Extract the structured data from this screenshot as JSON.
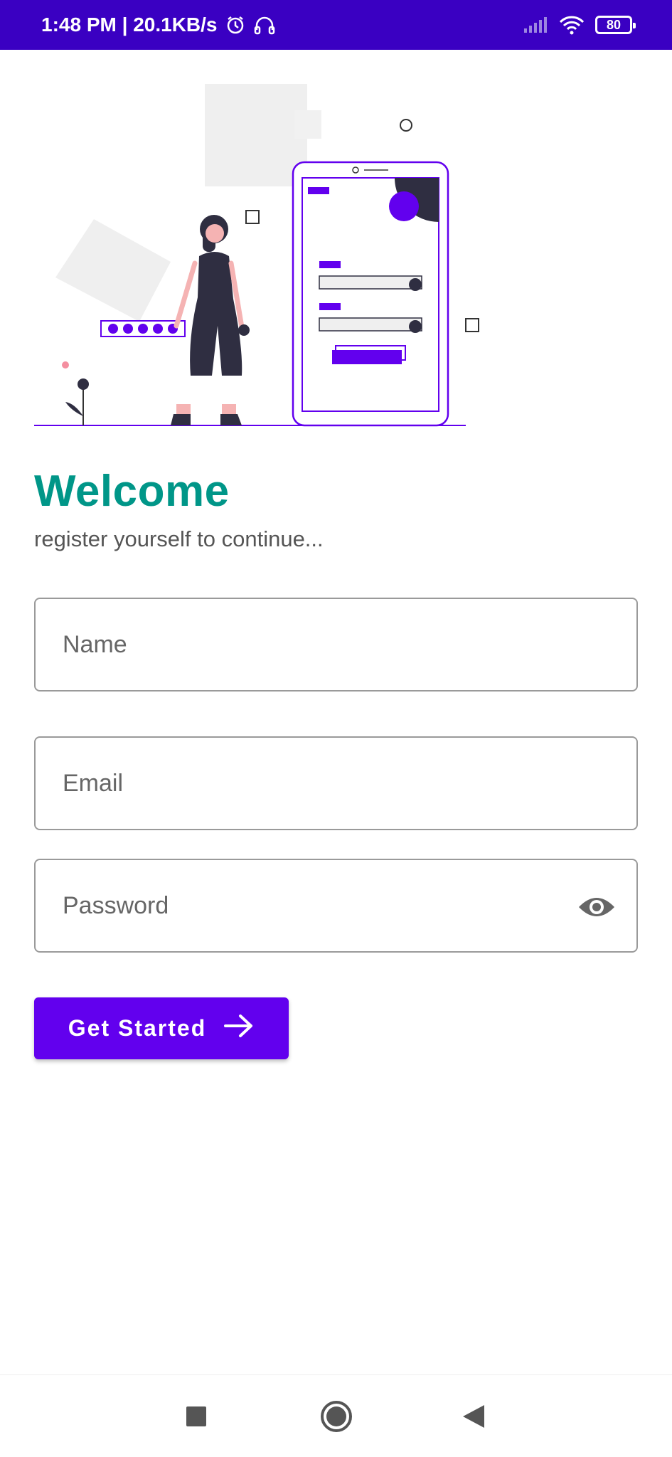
{
  "status_bar": {
    "time_speed": "1:48 PM | 20.1KB/s",
    "battery": "80",
    "background": "#3a00c2"
  },
  "icons": {
    "alarm": "alarm-icon",
    "headset": "headset-icon",
    "signal": "signal-icon",
    "wifi": "wifi-icon",
    "battery": "battery-icon",
    "eye": "eye-icon",
    "arrow": "arrow-right-icon",
    "nav_recents": "square-icon",
    "nav_home": "circle-icon",
    "nav_back": "triangle-back-icon"
  },
  "header": {
    "title": "Welcome",
    "subtitle": "register yourself to continue..."
  },
  "form": {
    "name_placeholder": "Name",
    "email_placeholder": "Email",
    "password_placeholder": "Password",
    "submit_label": "Get Started"
  },
  "colors": {
    "accent": "#6200ee",
    "title": "#009688"
  }
}
